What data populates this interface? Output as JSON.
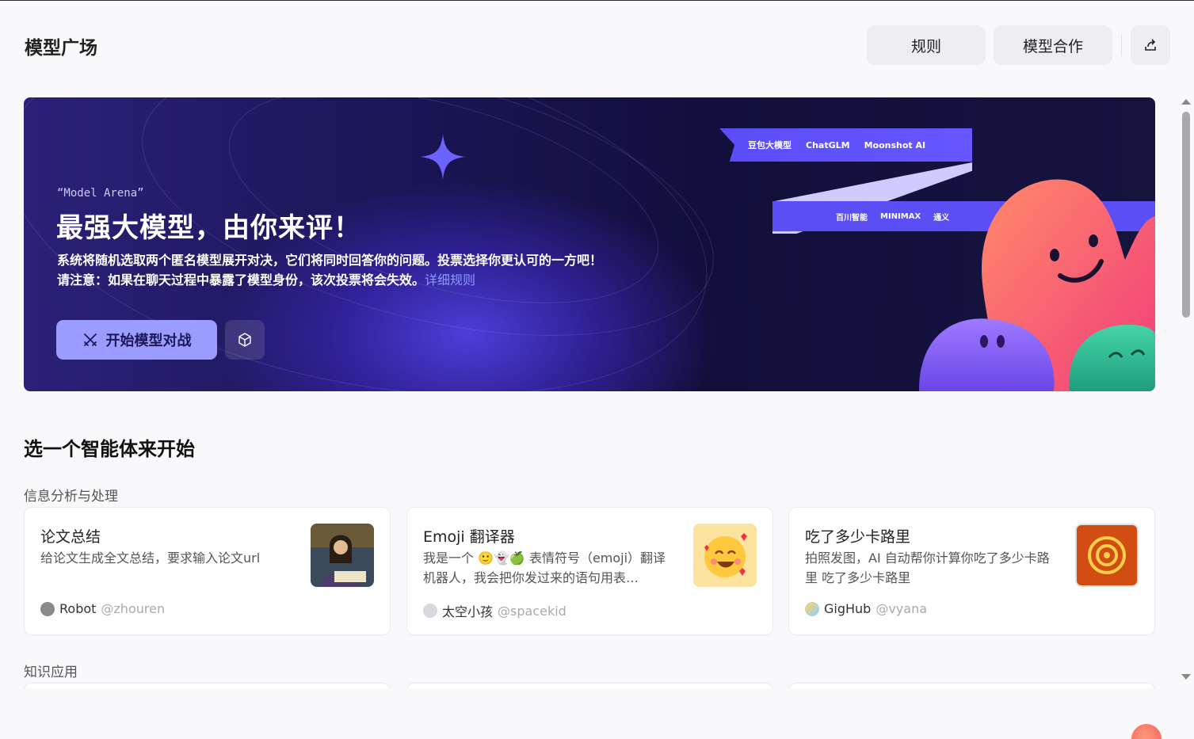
{
  "header": {
    "title": "模型广场",
    "rules_label": "规则",
    "coop_label": "模型合作"
  },
  "banner": {
    "eyebrow": "“Model Arena”",
    "title": "最强大模型，由你来评！",
    "desc_line1": "系统将随机选取两个匿名模型展开对决，它们将同时回答你的问题。投票选择你更认可的一方吧！",
    "desc_line2": "请注意：如果在聊天过程中暴露了模型身份，该次投票将会失效。",
    "detail_link": "详细规则",
    "start_label": "开始模型对战",
    "logos_top": [
      "豆包大模型",
      "ChatGLM",
      "Moonshot AI"
    ],
    "logos_bottom": [
      "百川智能",
      "MINIMAX",
      "通义"
    ]
  },
  "section": {
    "title": "选一个智能体来开始",
    "categories": [
      {
        "label": "信息分析与处理",
        "cards": [
          {
            "title": "论文总结",
            "desc": "给论文生成全文总结，要求输入论文url",
            "author": "Robot",
            "handle": "@zhouren"
          },
          {
            "title": "Emoji 翻译器",
            "desc": "我是一个 🙂👻🍏 表情符号（emoji）翻译机器人，我会把你发过来的语句用表…",
            "author": "太空小孩",
            "handle": "@spacekid"
          },
          {
            "title": "吃了多少卡路里",
            "desc": "拍照发图，AI 自动帮你计算你吃了多少卡路里 吃了多少卡路里",
            "author": "GigHub",
            "handle": "@vyana"
          }
        ]
      },
      {
        "label": "知识应用"
      }
    ]
  },
  "colors": {
    "accent": "#9c9bff",
    "link": "#8f9bff",
    "banner_dark": "#120f3c"
  }
}
